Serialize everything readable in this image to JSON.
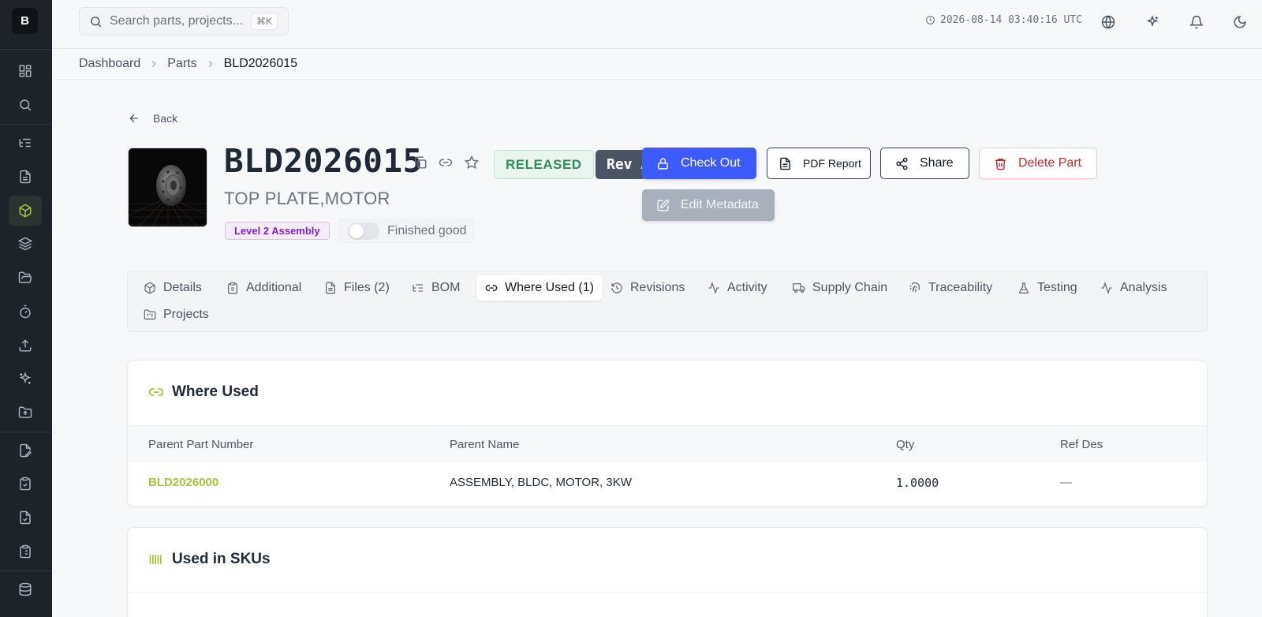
{
  "sidebar": {
    "logo": "B"
  },
  "topbar": {
    "search_placeholder": "Search parts, projects...",
    "search_shortcut": "⌘K",
    "datetime": "2026-08-14 03:40:16 UTC"
  },
  "breadcrumb": [
    "Dashboard",
    "Parts",
    "BLD2026015"
  ],
  "back_label": "Back",
  "part": {
    "number": "BLD2026015",
    "description": "TOP PLATE,MOTOR",
    "status": "RELEASED",
    "revision": "Rev A",
    "level": "Level 2 Assembly",
    "finished_good_label": "Finished good",
    "finished_good": false
  },
  "actions": {
    "check_out": "Check Out",
    "pdf_report": "PDF Report",
    "share": "Share",
    "delete": "Delete Part",
    "edit_metadata": "Edit Metadata"
  },
  "tabs": [
    {
      "label": "Details",
      "icon": "cube-icon"
    },
    {
      "label": "Additional",
      "icon": "clipboard-icon"
    },
    {
      "label": "Files (2)",
      "icon": "file-icon"
    },
    {
      "label": "BOM",
      "icon": "list-tree-icon"
    },
    {
      "label": "Where Used (1)",
      "icon": "link-icon",
      "active": true
    },
    {
      "label": "Revisions",
      "icon": "history-icon"
    },
    {
      "label": "Activity",
      "icon": "activity-icon"
    },
    {
      "label": "Supply Chain",
      "icon": "truck-icon"
    },
    {
      "label": "Traceability",
      "icon": "fingerprint-icon"
    },
    {
      "label": "Testing",
      "icon": "flask-icon"
    },
    {
      "label": "Analysis",
      "icon": "activity-icon"
    },
    {
      "label": "Projects",
      "icon": "folder-kanban-icon"
    }
  ],
  "where_used": {
    "title": "Where Used",
    "columns": [
      "Parent Part Number",
      "Parent Name",
      "Qty",
      "Ref Des"
    ],
    "rows": [
      {
        "parent_part_number": "BLD2026000",
        "parent_name": "ASSEMBLY, BLDC, MOTOR, 3KW",
        "qty": "1.0000",
        "ref_des": "—"
      }
    ]
  },
  "used_in_skus": {
    "title": "Used in SKUs"
  },
  "colors": {
    "accent": "#a4c639",
    "primary": "#3b5bfd",
    "danger": "#c62828",
    "sidebar": "#1e2329"
  }
}
